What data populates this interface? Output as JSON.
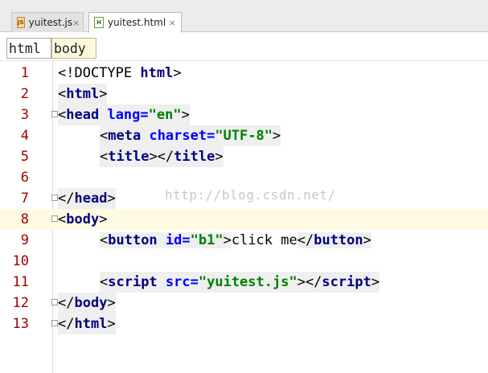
{
  "tabs": [
    {
      "label": "yuitest.js",
      "icon": "js-file-icon",
      "active": false
    },
    {
      "label": "yuitest.html",
      "icon": "html-file-icon",
      "active": true
    }
  ],
  "tab_close_glyph": "×",
  "breadcrumb": [
    "html",
    "body"
  ],
  "code": {
    "line_numbers": [
      "1",
      "2",
      "3",
      "4",
      "5",
      "6",
      "7",
      "8",
      "9",
      "10",
      "11",
      "12",
      "13"
    ],
    "l1": {
      "a": "<!DOCTYPE ",
      "b": "html",
      "c": ">"
    },
    "l2": {
      "a": "<",
      "b": "html",
      "c": ">"
    },
    "l3": {
      "a": "<",
      "b": "head",
      "c": " ",
      "d": "lang=",
      "e": "\"en\"",
      "f": ">"
    },
    "l4": {
      "a": "<",
      "b": "meta",
      "c": " ",
      "d": "charset=",
      "e": "\"UTF-8\"",
      "f": ">"
    },
    "l5": {
      "a": "<",
      "b": "title",
      "c": "></",
      "d": "title",
      "e": ">"
    },
    "l7": {
      "a": "</",
      "b": "head",
      "c": ">"
    },
    "l8": {
      "a": "<",
      "b": "body",
      "c": ">"
    },
    "l9": {
      "a": "<",
      "b": "button",
      "c": " ",
      "d": "id=",
      "e": "\"b1\"",
      "f": ">",
      "g": "click me",
      "h": "</",
      "i": "button",
      "j": ">"
    },
    "l11": {
      "a": "<",
      "b": "script",
      "c": " ",
      "d": "src=",
      "e": "\"yuitest.js\"",
      "f": "></",
      "g": "script",
      "h": ">"
    },
    "l12": {
      "a": "</",
      "b": "body",
      "c": ">"
    },
    "l13": {
      "a": "</",
      "b": "html",
      "c": ">"
    }
  },
  "watermark": "http://blog.csdn.net/",
  "colors": {
    "tag": "#000080",
    "attribute": "#0000ff",
    "string": "#008000",
    "line_number": "#a00000",
    "current_line": "#fffbe3"
  }
}
